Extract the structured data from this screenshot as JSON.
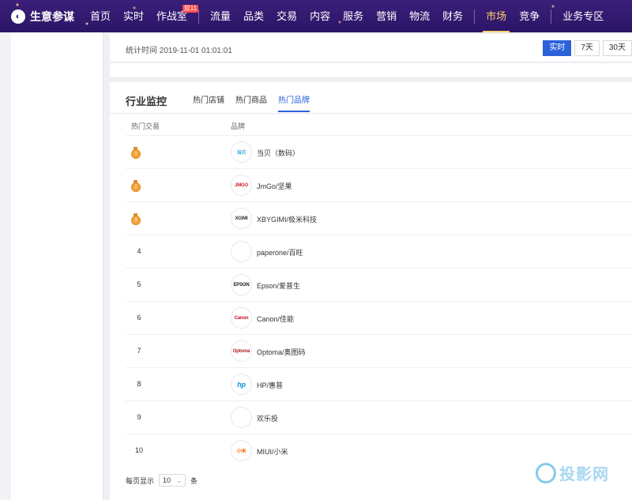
{
  "nav": {
    "logo_text": "生意参谋",
    "items": [
      {
        "label": "首页"
      },
      {
        "label": "实时"
      },
      {
        "label": "作战室",
        "badge": "双11"
      },
      {
        "label": "流量"
      },
      {
        "label": "品类"
      },
      {
        "label": "交易"
      },
      {
        "label": "内容"
      },
      {
        "label": "服务"
      },
      {
        "label": "营销"
      },
      {
        "label": "物流"
      },
      {
        "label": "财务"
      },
      {
        "label": "市场",
        "active": true
      },
      {
        "label": "竞争"
      },
      {
        "label": "业务专区"
      }
    ]
  },
  "stats": {
    "time_text": "统计时间 2019-11-01 01:01:01",
    "ranges": [
      "实时",
      "7天",
      "30天"
    ],
    "active_range": "实时"
  },
  "monitor": {
    "title": "行业监控",
    "tabs": [
      "热门店铺",
      "热门商品",
      "热门品牌"
    ],
    "active_tab": "热门品牌",
    "columns": [
      "热门交易",
      "品牌"
    ],
    "rows": [
      {
        "rank": "1",
        "medal": true,
        "logo": "当贝",
        "brand": "当贝（数码）"
      },
      {
        "rank": "2",
        "medal": true,
        "logo": "JMGO",
        "brand": "JmGo/坚果"
      },
      {
        "rank": "3",
        "medal": true,
        "logo": "XGIMI",
        "brand": "XBYGIMI/极米科技"
      },
      {
        "rank": "4",
        "medal": false,
        "logo": "",
        "brand": "paperone/百旺"
      },
      {
        "rank": "5",
        "medal": false,
        "logo": "EPSON",
        "brand": "Epson/爱普生"
      },
      {
        "rank": "6",
        "medal": false,
        "logo": "Canon",
        "brand": "Canon/佳能"
      },
      {
        "rank": "7",
        "medal": false,
        "logo": "Optoma",
        "brand": "Optoma/奥图码"
      },
      {
        "rank": "8",
        "medal": false,
        "logo": "hp",
        "brand": "HP/惠普"
      },
      {
        "rank": "9",
        "medal": false,
        "logo": "",
        "brand": "欢乐投"
      },
      {
        "rank": "10",
        "medal": false,
        "logo": "小米",
        "brand": "MIUI/小米"
      }
    ],
    "footer": {
      "prefix": "每页显示",
      "page_size": "10",
      "suffix": "条"
    }
  },
  "watermark": {
    "text": "投影网"
  },
  "colors": {
    "nav_bg": "#3b1f7a",
    "accent": "#2b62d9",
    "active_nav": "#ffd36b",
    "medal": "#f3a53a"
  }
}
